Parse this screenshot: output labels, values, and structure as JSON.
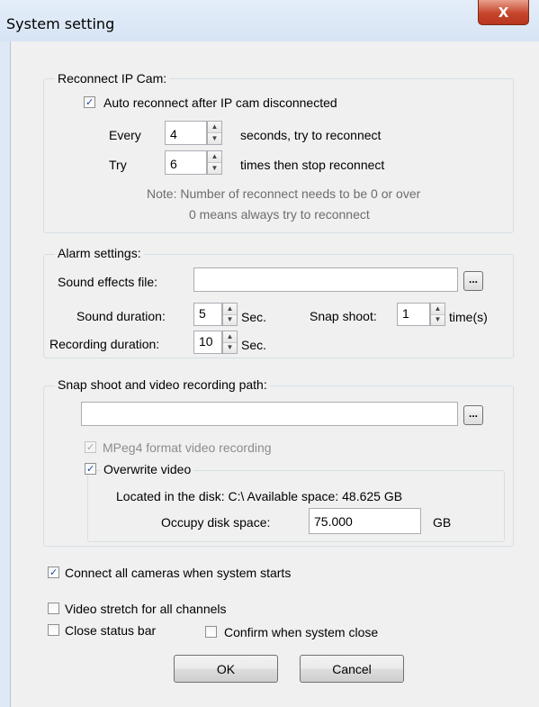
{
  "window": {
    "title": "System setting",
    "close_glyph": "X"
  },
  "reconnect": {
    "group_label": "Reconnect IP Cam:",
    "auto_label": "Auto reconnect after IP cam disconnected",
    "auto_checked": true,
    "every_label": "Every",
    "every_value": "4",
    "every_suffix": "seconds, try to reconnect",
    "try_label": "Try",
    "try_value": "6",
    "try_suffix": "times then stop reconnect",
    "note_line1": "Note: Number of reconnect needs to be 0 or over",
    "note_line2": "0 means always try to reconnect"
  },
  "alarm": {
    "group_label": "Alarm settings:",
    "sound_file_label": "Sound effects file:",
    "sound_file_value": "",
    "browse_label": "...",
    "sound_duration_label": "Sound duration:",
    "sound_duration_value": "5",
    "sound_duration_unit": "Sec.",
    "snap_label": "Snap shoot:",
    "snap_value": "1",
    "snap_unit": "time(s)",
    "recording_label": "Recording duration:",
    "recording_value": "10",
    "recording_unit": "Sec."
  },
  "path": {
    "group_label": "Snap shoot and video recording path:",
    "path_value": "",
    "browse_label": "...",
    "mpeg4_label": "MPeg4 format video recording",
    "mpeg4_checked": true,
    "overwrite_label": "Overwrite video",
    "overwrite_checked": true,
    "located_text": "Located in the disk: C:\\  Available space: 48.625 GB",
    "occupy_label": "Occupy disk space:",
    "occupy_value": "75.000",
    "occupy_unit": "GB"
  },
  "options": {
    "connect_all_label": "Connect all cameras when system starts",
    "connect_all_checked": true,
    "stretch_label": "Video stretch for all channels",
    "stretch_checked": false,
    "close_status_label": "Close status bar",
    "close_status_checked": false,
    "confirm_close_label": "Confirm when system close",
    "confirm_close_checked": false
  },
  "buttons": {
    "ok": "OK",
    "cancel": "Cancel"
  },
  "check_glyph": "✓",
  "spin_up_glyph": "▲",
  "spin_down_glyph": "▼"
}
